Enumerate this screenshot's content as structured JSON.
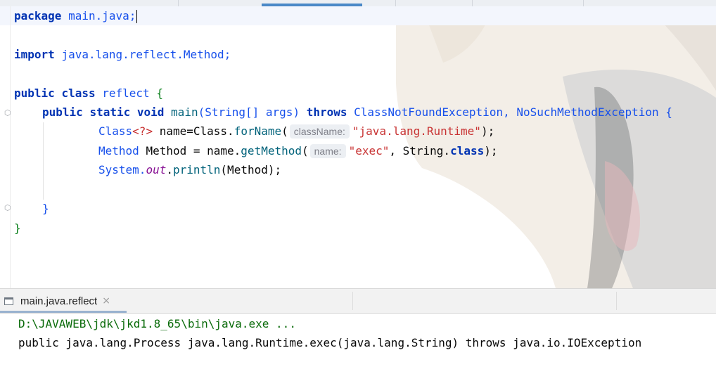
{
  "editor": {
    "lines": {
      "l1": {
        "kw": "package",
        "pkg": "main.java;"
      },
      "l2": {
        "kw": "import",
        "path": "java.lang.reflect.Method;"
      },
      "l3": {
        "kw1": "public",
        "kw2": "class",
        "name": "reflect",
        "brace": "{"
      },
      "l4": {
        "kw1": "public",
        "kw2": "static",
        "kw3": "void",
        "method": "main",
        "params": "(String[] args)",
        "throws_kw": "throws",
        "exceptions": "ClassNotFoundException, NoSuchMethodException {"
      },
      "l5": {
        "type": "Class",
        "generic": "<?>",
        "assign": "name=Class.",
        "call": "forName",
        "open": "(",
        "hint": "className:",
        "arg": "\"java.lang.Runtime\"",
        "close": ");"
      },
      "l6": {
        "type": "Method",
        "var": "Method = name.",
        "call": "getMethod",
        "open": "(",
        "hint": "name:",
        "arg": "\"exec\"",
        "rest": ", String.",
        "kw": "class",
        "close": ");"
      },
      "l7": {
        "obj": "System.",
        "field": "out",
        "dot": ".",
        "call": "println",
        "args": "(Method);"
      },
      "l8": {
        "brace": "}"
      },
      "l9": {
        "brace": "}"
      }
    }
  },
  "run_panel": {
    "tab_label": "main.java.reflect",
    "close_symbol": "×",
    "console": {
      "command": "D:\\JAVAWEB\\jdk\\jkd1.8_65\\bin\\java.exe ...",
      "output": "public java.lang.Process java.lang.Runtime.exec(java.lang.String) throws java.io.IOException"
    }
  },
  "icons": {
    "run_tab_icon": "console-window-icon",
    "fold_icons": "fold-marker-icon"
  },
  "colors": {
    "keyword": "#0033b3",
    "string": "#067d17",
    "method": "#00627a",
    "console_command": "#0a6b0a",
    "tab_accent": "#4a88c7"
  }
}
